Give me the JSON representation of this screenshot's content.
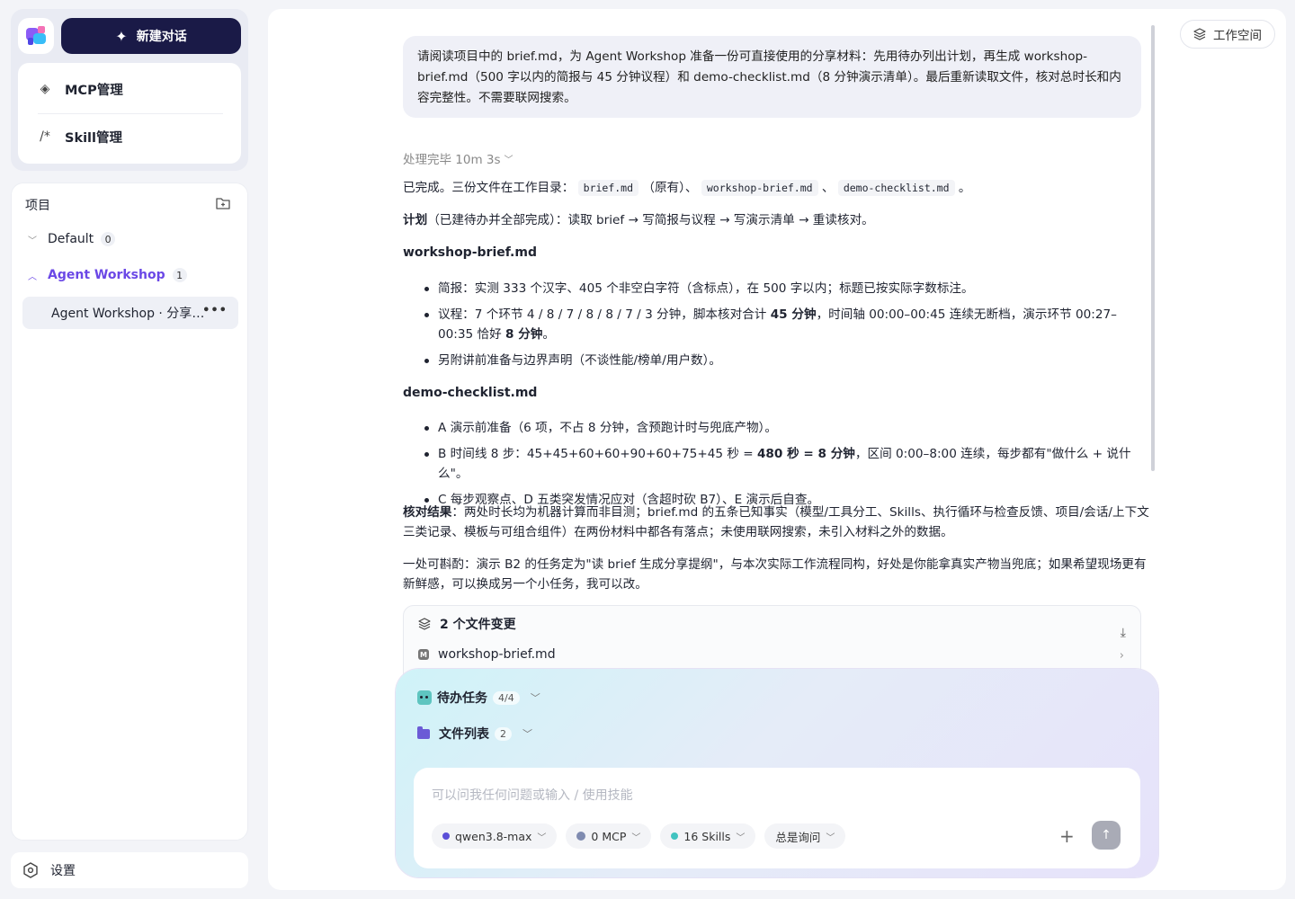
{
  "sidebar": {
    "new_chat_label": "新建对话",
    "mgmt": [
      {
        "label": "MCP管理",
        "icon": "diamond-icon"
      },
      {
        "label": "Skill管理",
        "icon": "slash-star-icon"
      }
    ],
    "projects_title": "项目",
    "projects": [
      {
        "name": "Default",
        "count": "0",
        "expanded": false
      },
      {
        "name": "Agent Workshop",
        "count": "1",
        "expanded": true
      }
    ],
    "session": "Agent Workshop · 分享材料准备",
    "settings_label": "设置"
  },
  "header": {
    "workspace_label": "工作空间"
  },
  "chat": {
    "user_message": "请阅读项目中的 brief.md，为 Agent Workshop 准备一份可直接使用的分享材料：先用待办列出计划，再生成 workshop-brief.md（500 字以内的简报与 45 分钟议程）和 demo-checklist.md（8 分钟演示清单）。最后重新读取文件，核对总时长和内容完整性。不需要联网搜索。",
    "status": "处理完毕 10m 3s",
    "done_prefix": "已完成。三份文件在工作目录：",
    "files": [
      "brief.md",
      "workshop-brief.md",
      "demo-checklist.md"
    ],
    "existing_note": "（原有）、",
    "sep": "、",
    "period": "。",
    "plan_label": "计划",
    "plan_text": "（已建待办并全部完成）：读取 brief → 写简报与议程 → 写演示清单 → 重读核对。",
    "section1_title": "workshop-brief.md",
    "section1_items": [
      {
        "pre": "简报：实测 333 个汉字、405 个非空白字符（含标点），在 500 字以内；标题已按实际字数标注。"
      },
      {
        "pre": "议程：7 个环节 4 / 8 / 7 / 8 / 8 / 7 / 3 分钟，脚本核对合计 ",
        "bold": "45 分钟",
        "mid": "，时间轴 00:00–00:45 连续无断档，演示环节 00:27–00:35 恰好 ",
        "bold2": "8 分钟",
        "post": "。"
      },
      {
        "pre": "另附讲前准备与边界声明（不谈性能/榜单/用户数）。"
      }
    ],
    "section2_title": "demo-checklist.md",
    "section2_items": [
      {
        "pre": "A 演示前准备（6 项，不占 8 分钟，含预跑计时与兜底产物）。"
      },
      {
        "pre": "B 时间线 8 步：45+45+60+60+90+60+75+45 秒 = ",
        "bold": "480 秒 = 8 分钟",
        "mid": "，区间 0:00–8:00 连续，每步都有\"做什么 + 说什么\"。"
      },
      {
        "pre": "C 每步观察点、D 五类突发情况应对（含超时砍 B7）、E 演示后自查。"
      }
    ],
    "verify_label": "核对结果",
    "verify_text": "：两处时长均为机器计算而非目测；brief.md 的五条已知事实（模型/工具分工、Skills、执行循环与检查反馈、项目/会话/上下文三类记录、模板与可组合组件）在两份材料中都各有落点；未使用联网搜索，未引入材料之外的数据。",
    "note_text": "一处可斟酌：演示 B2 的任务定为\"读 brief 生成分享提纲\"，与本次实际工作流程同构，好处是你能拿真实产物当兜底；如果希望现场更有新鲜感，可以换成另一个小任务，我可以改。"
  },
  "changes": {
    "title": "2 个文件变更",
    "files": [
      "workshop-brief.md"
    ]
  },
  "composer": {
    "todo_label": "待办任务",
    "todo_count": "4/4",
    "files_label": "文件列表",
    "files_count": "2",
    "placeholder": "可以问我任何问题或输入 / 使用技能",
    "chips": [
      {
        "label": "qwen3.8-max",
        "dot_color": "#5b4fd8"
      },
      {
        "label": "0 MCP",
        "dot_color": "#7f8bb0"
      },
      {
        "label": "16 Skills",
        "dot_color": "#41c3c0"
      },
      {
        "label": "总是询问",
        "dot_color": ""
      }
    ]
  },
  "colors": {
    "accent": "#6b48e6",
    "new_chat_bg": "#1a1a47"
  }
}
